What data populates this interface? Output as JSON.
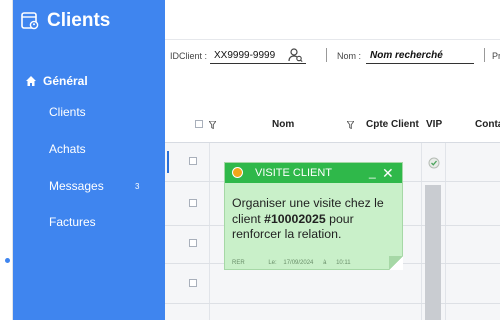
{
  "app": {
    "title": "Clients"
  },
  "sidebar": {
    "section": "Général",
    "items": [
      {
        "label": "Clients"
      },
      {
        "label": "Achats"
      },
      {
        "label": "Messages",
        "badge": "3"
      },
      {
        "label": "Factures"
      }
    ]
  },
  "filters": {
    "idclient_label": "IDClient :",
    "idclient_value": "XX9999-9999",
    "nom_label": "Nom :",
    "nom_value": "Nom recherché",
    "extra_label": "Pr"
  },
  "table": {
    "columns": [
      "Nom",
      "Cpte Client",
      "VIP",
      "Conta"
    ]
  },
  "note": {
    "title": "VISITE CLIENT",
    "minimize": "_",
    "close": "✕",
    "text_before": "Organiser une visite chez le client ",
    "text_bold": "#10002025",
    "text_after": " pour renforcer la relation.",
    "author": "RER",
    "date_label": "Le:",
    "date": "17/09/2024",
    "time_sep": "à",
    "time": "10:11"
  },
  "colors": {
    "sidebar": "#3f85ef",
    "note_header": "#2fb84a",
    "note_body": "#c9f0c9"
  }
}
